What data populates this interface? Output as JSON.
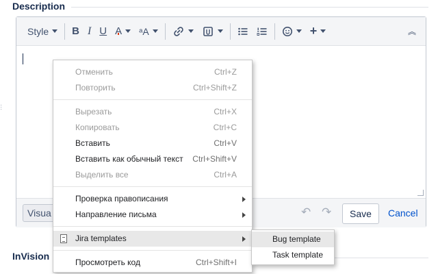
{
  "section": {
    "title": "Description",
    "title2": "InVision"
  },
  "toolbar": {
    "style_label": "Style",
    "bold_label": "B",
    "italic_label": "I",
    "underline_label": "U",
    "color_label": "A",
    "text_color_accent": "#de350b",
    "size_label": "ᵃA",
    "link_icon": "link-icon",
    "attachment_icon": "attachment-icon",
    "bullet_icon": "bullet-list-icon",
    "numbered_icon": "numbered-list-icon",
    "emoji_icon": "emoji-icon",
    "plus_label": "+",
    "collapse_label": "︽"
  },
  "footer": {
    "visual_label": "Visua",
    "save_label": "Save",
    "cancel_label": "Cancel",
    "link_color": "#0052cc"
  },
  "context_menu": {
    "undo": {
      "label": "Отменить",
      "shortcut": "Ctrl+Z"
    },
    "redo": {
      "label": "Повторить",
      "shortcut": "Ctrl+Shift+Z"
    },
    "cut": {
      "label": "Вырезать",
      "shortcut": "Ctrl+X"
    },
    "copy": {
      "label": "Копировать",
      "shortcut": "Ctrl+C"
    },
    "paste": {
      "label": "Вставить",
      "shortcut": "Ctrl+V"
    },
    "paste_plain": {
      "label": "Вставить как обычный текст",
      "shortcut": "Ctrl+Shift+V"
    },
    "select_all": {
      "label": "Выделить все",
      "shortcut": "Ctrl+A"
    },
    "spellcheck": {
      "label": "Проверка правописания"
    },
    "direction": {
      "label": "Направление письма"
    },
    "jira_templates": {
      "label": "Jira templates"
    },
    "view_source": {
      "label": "Просмотреть код",
      "shortcut": "Ctrl+Shift+I"
    }
  },
  "submenu": {
    "items": [
      "Bug template",
      "Task template"
    ]
  }
}
